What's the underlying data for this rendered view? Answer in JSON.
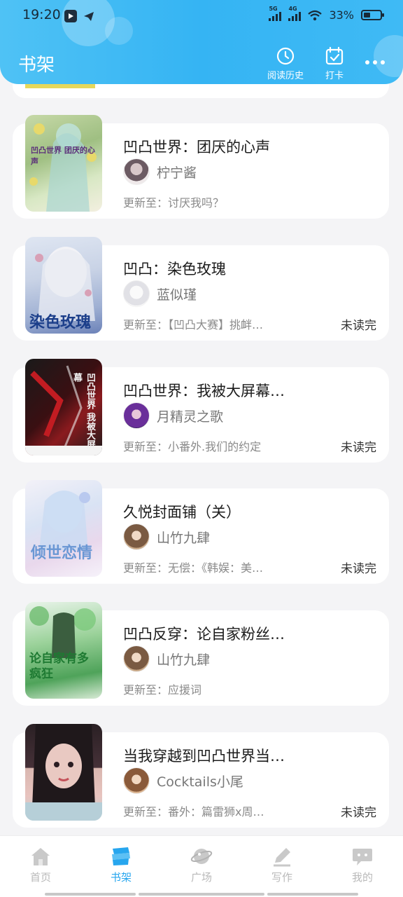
{
  "status_bar": {
    "time": "19:20",
    "network1": "5G",
    "network2": "4G",
    "battery": "33%"
  },
  "header": {
    "title": "书架",
    "history_label": "阅读历史",
    "checkin_label": "打卡"
  },
  "colors": {
    "brand": "#35b4f3",
    "active_tab": "#27a6ee"
  },
  "books": [
    {
      "title": "凹凸世界：团厌的心声",
      "author": "柠宁酱",
      "update": "更新至：讨厌我吗？",
      "unread": "",
      "cover_text": "凹凸世界 团厌的心声"
    },
    {
      "title": "凹凸：染色玫瑰",
      "author": "蓝似瑾",
      "update": "更新至：【凹凸大赛】挑衅…",
      "unread": "未读完",
      "cover_text": "染色玫瑰"
    },
    {
      "title": "凹凸世界：我被大屏幕…",
      "author": "月精灵之歌",
      "update": "更新至：小番外.我们的约定",
      "unread": "未读完",
      "cover_text": "凹凸世界 我被大屏幕"
    },
    {
      "title": "久悦封面铺（关）",
      "author": "山竹九肆",
      "update": "更新至：无偿：《韩娱：美…",
      "unread": "未读完",
      "cover_text": "倾世恋情"
    },
    {
      "title": "凹凸反穿：论自家粉丝…",
      "author": "山竹九肆",
      "update": "更新至：应援词",
      "unread": "",
      "cover_text": "论自家有多疯狂"
    },
    {
      "title": "当我穿越到凹凸世界当…",
      "author": "Cocktails小尾",
      "update": "更新至：番外：篇雷狮x周…",
      "unread": "未读完",
      "cover_text": ""
    }
  ],
  "nav": [
    {
      "label": "首页",
      "icon": "home-icon"
    },
    {
      "label": "书架",
      "icon": "bookshelf-icon"
    },
    {
      "label": "广场",
      "icon": "planet-icon"
    },
    {
      "label": "写作",
      "icon": "pen-icon"
    },
    {
      "label": "我的",
      "icon": "chat-face-icon"
    }
  ]
}
